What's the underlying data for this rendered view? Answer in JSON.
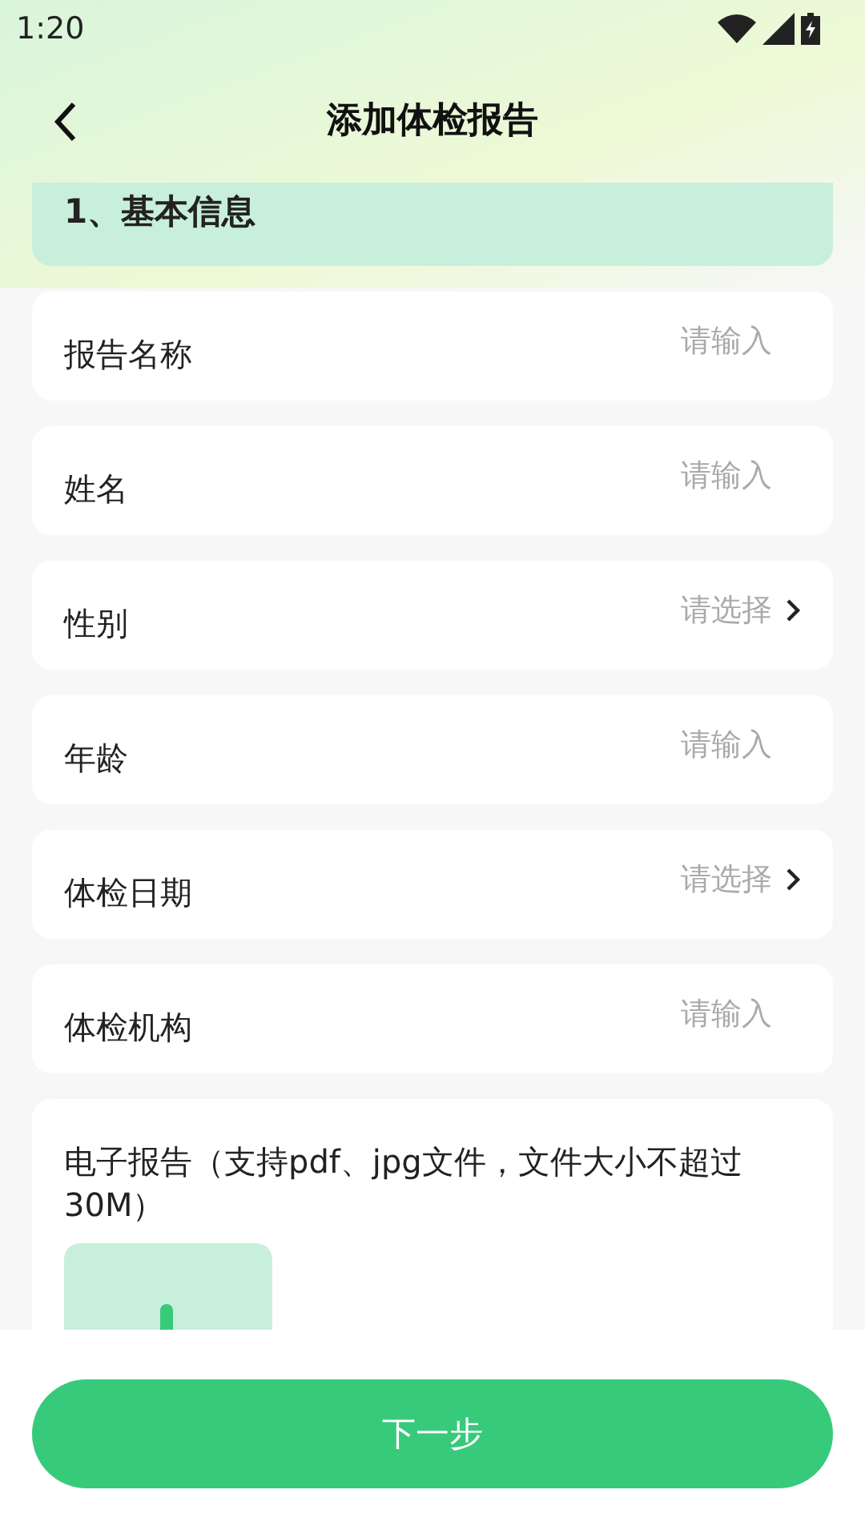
{
  "status_bar": {
    "time": "1:20"
  },
  "header": {
    "title": "添加体检报告"
  },
  "section": {
    "title": "1、基本信息"
  },
  "fields": [
    {
      "label": "报告名称",
      "placeholder": "请输入",
      "kind": "input"
    },
    {
      "label": "姓名",
      "placeholder": "请输入",
      "kind": "input"
    },
    {
      "label": "性别",
      "placeholder": "请选择",
      "kind": "select"
    },
    {
      "label": "年龄",
      "placeholder": "请输入",
      "kind": "input"
    },
    {
      "label": "体检日期",
      "placeholder": "请选择",
      "kind": "select"
    },
    {
      "label": "体检机构",
      "placeholder": "请输入",
      "kind": "input"
    }
  ],
  "upload": {
    "label": "电子报告（支持pdf、jpg文件，文件大小不超过30M）"
  },
  "next_button": "下一步"
}
